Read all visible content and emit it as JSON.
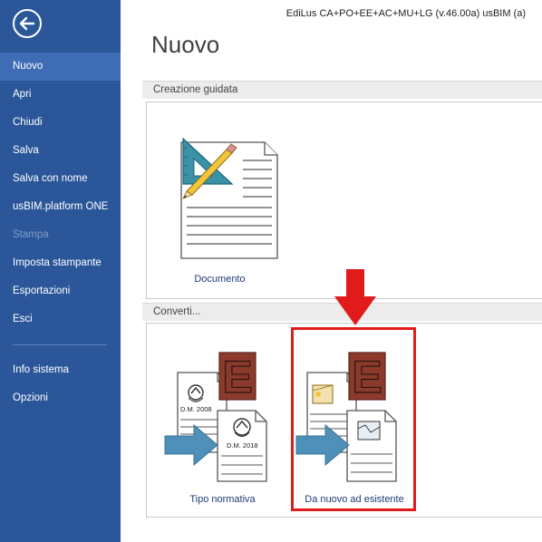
{
  "app": {
    "title": "EdiLus CA+PO+EE+AC+MU+LG (v.46.00a) usBIM (a)"
  },
  "sidebar": {
    "items": [
      {
        "label": "Nuovo",
        "state": "active"
      },
      {
        "label": "Apri",
        "state": "normal"
      },
      {
        "label": "Chiudi",
        "state": "normal"
      },
      {
        "label": "Salva",
        "state": "normal"
      },
      {
        "label": "Salva con nome",
        "state": "normal"
      },
      {
        "label": "usBIM.platform ONE",
        "state": "normal"
      },
      {
        "label": "Stampa",
        "state": "disabled"
      },
      {
        "label": "Imposta stampante",
        "state": "normal"
      },
      {
        "label": "Esportazioni",
        "state": "normal"
      },
      {
        "label": "Esci",
        "state": "normal"
      }
    ],
    "bottom_items": [
      {
        "label": "Info sistema"
      },
      {
        "label": "Opzioni"
      }
    ]
  },
  "main": {
    "title": "Nuovo",
    "sections": [
      {
        "title": "Creazione guidata",
        "tiles": [
          {
            "label": "Documento",
            "icon": "document-with-triangle-pencil-icon"
          }
        ]
      },
      {
        "title": "Converti...",
        "tiles": [
          {
            "label": "Tipo normativa",
            "icon": "convert-normativa-icon",
            "doc_label_1": "D.M. 2008",
            "doc_label_2": "D.M. 2018",
            "badge": "E"
          },
          {
            "label": "Da nuovo ad esistente",
            "icon": "convert-new-to-existing-icon",
            "badge": "E",
            "highlighted": true
          }
        ]
      }
    ]
  },
  "colors": {
    "sidebar": "#2b579a",
    "sidebar_active": "#3e6db5",
    "highlight": "#e11b1b",
    "badge": "#8b3a2c",
    "arrow": "#4f90b8",
    "link_text": "#1f3b78"
  }
}
